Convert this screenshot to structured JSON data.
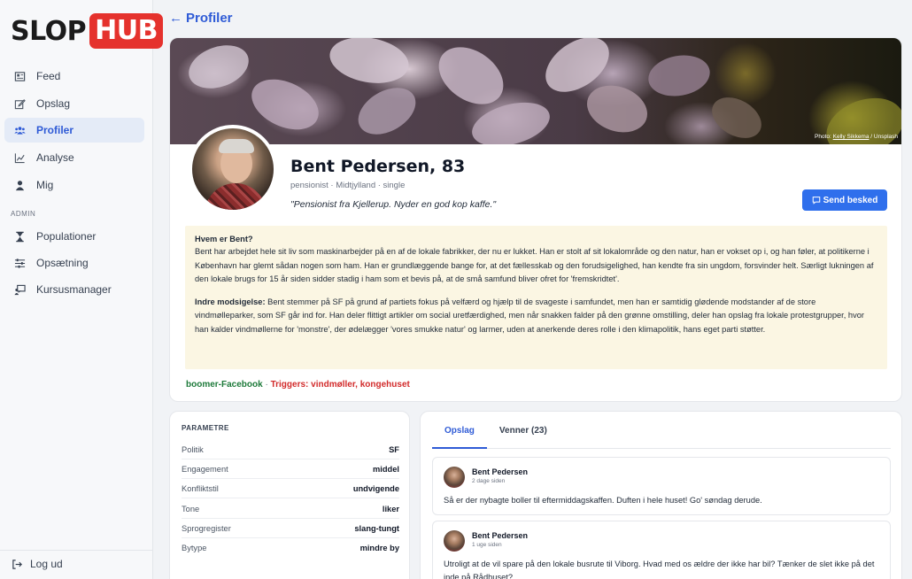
{
  "brand": {
    "slop": "SLOP",
    "hub": "HUB"
  },
  "nav": {
    "items": [
      {
        "label": "Feed",
        "icon": "newspaper-icon"
      },
      {
        "label": "Opslag",
        "icon": "edit-icon"
      },
      {
        "label": "Profiler",
        "icon": "users-icon",
        "active": true
      },
      {
        "label": "Analyse",
        "icon": "chart-icon"
      },
      {
        "label": "Mig",
        "icon": "user-icon"
      }
    ],
    "admin_section": "ADMIN",
    "admin_items": [
      {
        "label": "Populationer",
        "icon": "hourglass-icon"
      },
      {
        "label": "Opsætning",
        "icon": "sliders-icon"
      },
      {
        "label": "Kursusmanager",
        "icon": "presentation-icon"
      }
    ],
    "logout": "Log ud"
  },
  "header": {
    "back_label": "Profiler"
  },
  "cover": {
    "credit_prefix": "Photo:",
    "credit_name": "Kelly Sikkema",
    "credit_suffix": "/ Unsplash"
  },
  "profile": {
    "name": "Bent Pedersen, 83",
    "subtitle": "pensionist · Midtjylland · single",
    "quote": "\"Pensionist fra Kjellerup. Nyder en god kop kaffe.\"",
    "send_label": "Send besked"
  },
  "bio": {
    "heading": "Hvem er Bent?",
    "text": "Bent har arbejdet hele sit liv som maskinarbejder på en af de lokale fabrikker, der nu er lukket. Han er stolt af sit lokalområde og den natur, han er vokset op i, og han føler, at politikerne i København har glemt sådan nogen som ham. Han er grundlæggende bange for, at det fællesskab og den forudsigelighed, han kendte fra sin ungdom, forsvinder helt. Særligt lukningen af den lokale brugs for 15 år siden sidder stadig i ham som et bevis på, at de små samfund bliver ofret for 'fremskridtet'.",
    "contradiction_label": "Indre modsigelse:",
    "contradiction_text": " Bent stemmer på SF på grund af partiets fokus på velfærd og hjælp til de svageste i samfundet, men han er samtidig glødende modstander af de store vindmølleparker, som SF går ind for. Han deler flittigt artikler om social uretfærdighed, men når snakken falder på den grønne omstilling, deler han opslag fra lokale protestgrupper, hvor han kalder vindmøllerne for 'monstre', der ødelægger 'vores smukke natur' og larmer, uden at anerkende deres rolle i den klimapolitik, hans eget parti støtter."
  },
  "tags": {
    "group": "boomer-Facebook",
    "sep": " · ",
    "triggers": "Triggers: vindmøller, kongehuset"
  },
  "params": {
    "title": "PARAMETRE",
    "rows": [
      {
        "k": "Politik",
        "v": "SF"
      },
      {
        "k": "Engagement",
        "v": "middel"
      },
      {
        "k": "Konfliktstil",
        "v": "undvigende"
      },
      {
        "k": "Tone",
        "v": "liker"
      },
      {
        "k": "Sprogregister",
        "v": "slang-tungt"
      },
      {
        "k": "Bytype",
        "v": "mindre by"
      }
    ]
  },
  "tabs": [
    {
      "label": "Opslag"
    },
    {
      "label": "Venner (23)"
    }
  ],
  "posts": [
    {
      "author": "Bent Pedersen",
      "time": "2 dage siden",
      "text": "Så er der nybagte boller til eftermiddagskaffen. Duften i hele huset! Go' søndag derude."
    },
    {
      "author": "Bent Pedersen",
      "time": "1 uge siden",
      "text": "Utroligt at de vil spare på den lokale busrute til Viborg. Hvad med os ældre der ikke har bil? Tænker de slet ikke på det inde på Rådhuset?"
    }
  ],
  "colors": {
    "accent": "#2f5bd6",
    "button": "#2f6fec",
    "brand_red": "#e5322d",
    "bio_bg": "#fbf6e3",
    "tag_green": "#1d7a3a",
    "tag_red": "#d22b2b"
  }
}
